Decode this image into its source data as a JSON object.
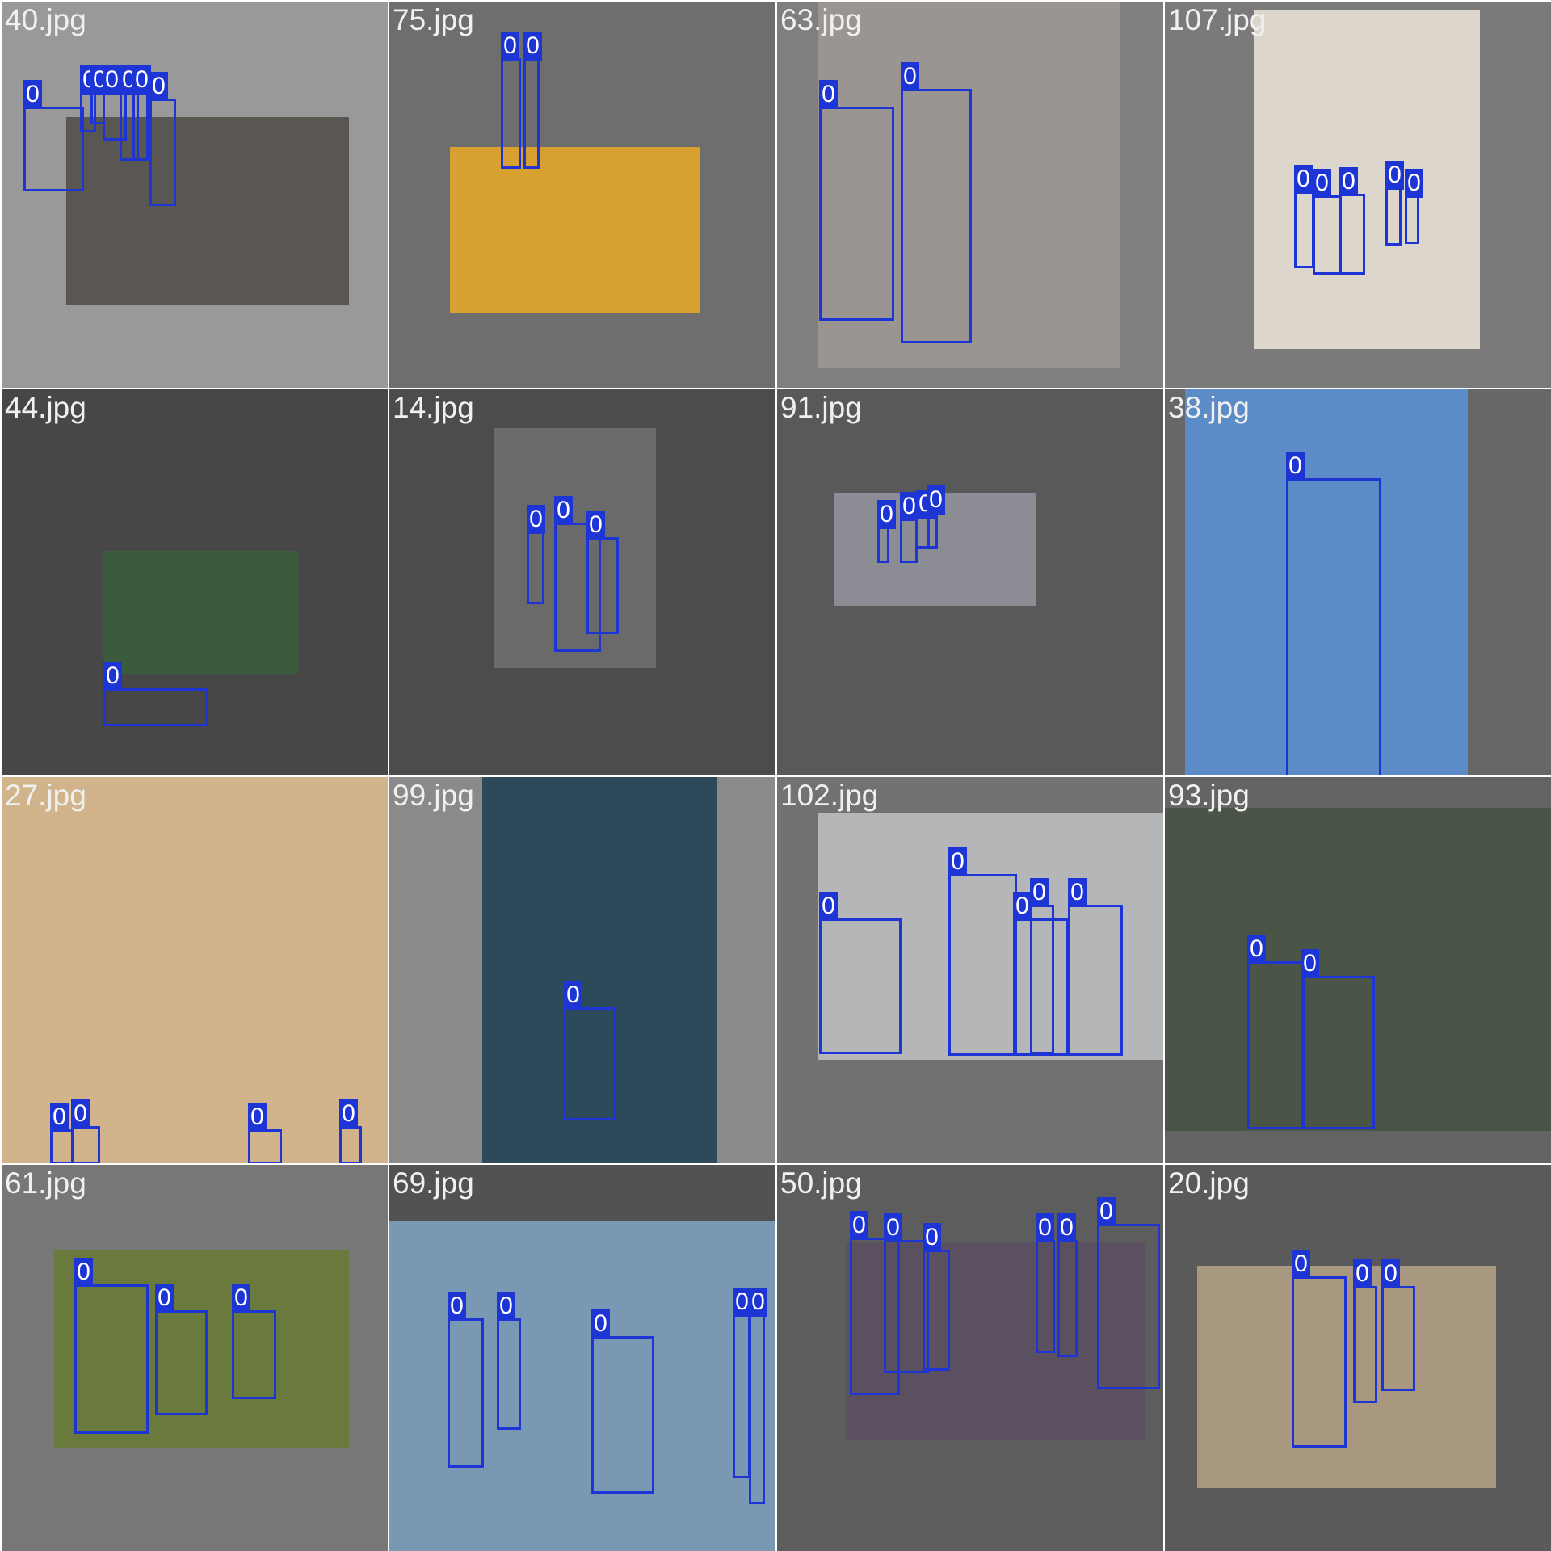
{
  "mosaic": {
    "tiles": [
      {
        "file": "40.jpg",
        "bg": "#999999",
        "photo": "#5a5752",
        "boxes": [
          "0",
          "0",
          "0",
          "0",
          "0",
          "0",
          "0"
        ]
      },
      {
        "file": "75.jpg",
        "bg": "#6e6e6e",
        "photo": "#d8a030",
        "boxes": [
          "0",
          "0"
        ]
      },
      {
        "file": "63.jpg",
        "bg": "#7f7f7f",
        "photo": "#9a9590",
        "boxes": [
          "0",
          "0"
        ]
      },
      {
        "file": "107.jpg",
        "bg": "#7a7a7a",
        "photo": "#dcd6cc",
        "boxes": [
          "0",
          "0",
          "0",
          "0",
          "0"
        ]
      },
      {
        "file": "44.jpg",
        "bg": "#474747",
        "photo": "#3b5c3c",
        "boxes": [
          "0"
        ]
      },
      {
        "file": "14.jpg",
        "bg": "#4c4c4c",
        "photo": "#6a6a6a",
        "boxes": [
          "0",
          "0",
          "0"
        ]
      },
      {
        "file": "91.jpg",
        "bg": "#595959",
        "photo": "#8c8c94",
        "boxes": [
          "0",
          "0",
          "0",
          "0",
          "0"
        ]
      },
      {
        "file": "38.jpg",
        "bg": "#676767",
        "photo": "#5c8cc8",
        "boxes": [
          "0"
        ]
      },
      {
        "file": "27.jpg",
        "bg": "#ffffff",
        "photo": "#d2b48c",
        "boxes": [
          "0",
          "0",
          "0",
          "0"
        ]
      },
      {
        "file": "99.jpg",
        "bg": "#8a8a8a",
        "photo": "#2c4a5a",
        "boxes": [
          "0"
        ]
      },
      {
        "file": "102.jpg",
        "bg": "#727272",
        "photo": "#b4b6b8",
        "boxes": [
          "0",
          "0",
          "0",
          "0",
          "0"
        ]
      },
      {
        "file": "93.jpg",
        "bg": "#646464",
        "photo": "#4a5548",
        "boxes": [
          "0",
          "0"
        ]
      },
      {
        "file": "61.jpg",
        "bg": "#777777",
        "photo": "#6a7a3c",
        "boxes": [
          "0",
          "0",
          "0"
        ]
      },
      {
        "file": "69.jpg",
        "bg": "#525252",
        "photo": "#7898b4",
        "boxes": [
          "0",
          "0",
          "0",
          "0",
          "0"
        ]
      },
      {
        "file": "50.jpg",
        "bg": "#5d5d5d",
        "photo": "#5a5060",
        "boxes": [
          "0",
          "0",
          "0",
          "0",
          "0",
          "0",
          "0"
        ]
      },
      {
        "file": "20.jpg",
        "bg": "#5a5a5a",
        "photo": "#a89880",
        "boxes": [
          "0",
          "0",
          "0"
        ]
      }
    ]
  }
}
